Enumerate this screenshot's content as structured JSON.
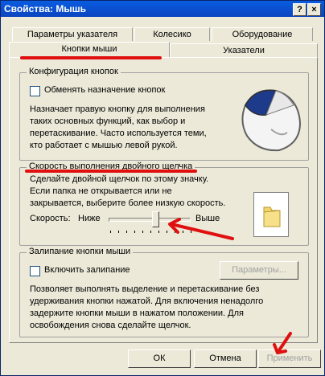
{
  "window": {
    "title": "Свойства: Мышь",
    "help_button": "?",
    "close_button": "×"
  },
  "tabs": {
    "row1": [
      "Параметры указателя",
      "Колесико",
      "Оборудование"
    ],
    "row2_active": "Кнопки мыши",
    "row2_other": "Указатели"
  },
  "button_config": {
    "title": "Конфигурация кнопок",
    "checkbox_label": "Обменять назначение кнопок",
    "description": [
      "Назначает правую кнопку для выполнения",
      "таких основных функций, как выбор и",
      "перетаскивание. Часто используется теми,",
      "кто работает с мышью левой рукой."
    ]
  },
  "double_click": {
    "title": "Скорость выполнения двойного щелчка",
    "description": [
      "Сделайте двойной щелчок по этому значку.",
      "Если папка не открывается или не",
      "закрывается, выберите более низкую скорость."
    ],
    "speed_label": "Скорость:",
    "slow_label": "Ниже",
    "fast_label": "Выше",
    "slider_value": 0.58
  },
  "click_lock": {
    "title": "Залипание кнопки мыши",
    "checkbox_label": "Включить залипание",
    "settings_button": "Параметры...",
    "description": [
      "Позволяет выполнять выделение и перетаскивание без",
      "удерживания кнопки нажатой. Для включения ненадолго",
      "задержите кнопки мыши в нажатом положении. Для",
      "освобождения снова сделайте щелчок."
    ]
  },
  "footer": {
    "ok": "ОК",
    "cancel": "Отмена",
    "apply": "Применить"
  },
  "colors": {
    "annotation_red": "#e01010",
    "titlebar_blue": "#0a5ce0",
    "dialog_bg": "#ece9d8"
  }
}
